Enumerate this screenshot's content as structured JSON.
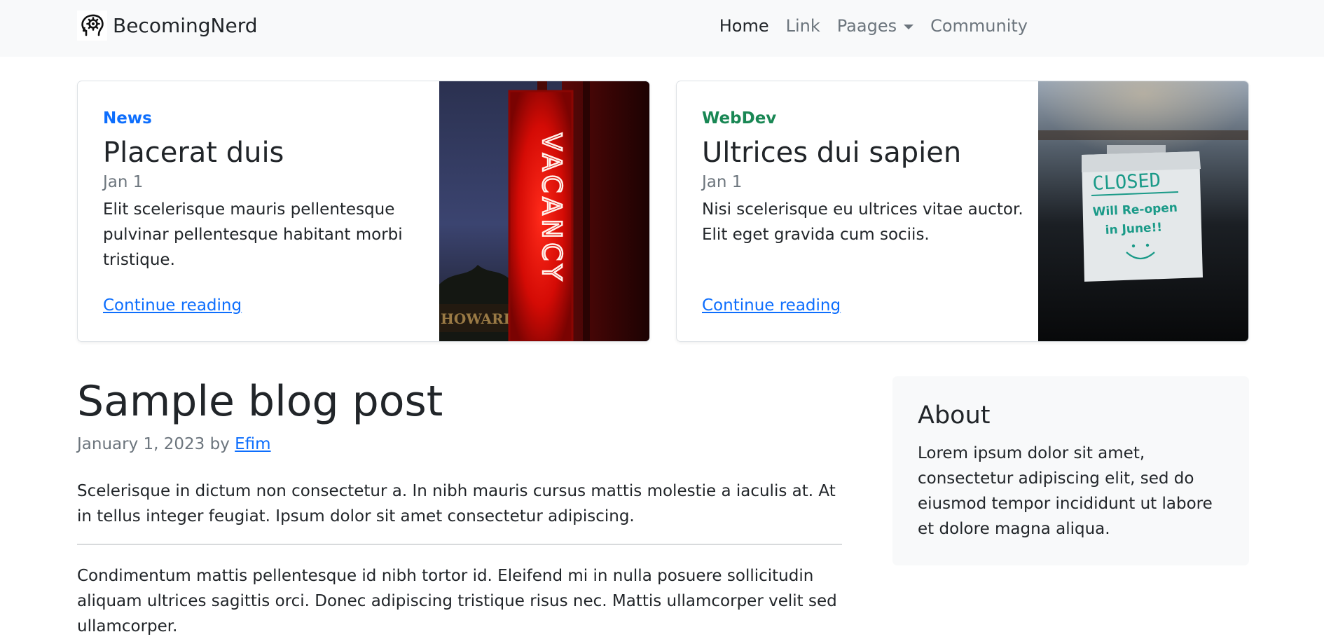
{
  "brand": {
    "name": "BecomingNerd",
    "logo_icon": "brain-gear-icon"
  },
  "nav": {
    "items": [
      {
        "label": "Home",
        "active": true
      },
      {
        "label": "Link",
        "active": false
      },
      {
        "label": "Paages",
        "active": false,
        "dropdown": true
      },
      {
        "label": "Community",
        "active": false
      }
    ]
  },
  "featured": [
    {
      "category": "News",
      "category_color": "#0d6efd",
      "title": "Placerat duis",
      "date": "Jan 1",
      "excerpt": "Elit scelerisque mauris pellentesque pulvinar pellentesque habitant morbi tristique.",
      "link": "Continue reading",
      "image": "neon-vacancy-sign-photo",
      "image_sign_text": "VACANCY",
      "image_storefront_text": "HOWARDS"
    },
    {
      "category": "WebDev",
      "category_color": "#198754",
      "title": "Ultrices dui sapien",
      "date": "Jan 1",
      "excerpt": "Nisi scelerisque eu ultrices vitae auctor. Elit eget gravida cum sociis.",
      "link": "Continue reading",
      "image": "closed-sign-window-photo",
      "image_note_line1": "CLOSED",
      "image_note_line2": "Will Re-open",
      "image_note_line3": "in June!!"
    }
  ],
  "post": {
    "title": "Sample blog post",
    "meta_prefix": "January 1, 2023 by ",
    "author": "Efim",
    "paragraph1": "Scelerisque in dictum non consectetur a. In nibh mauris cursus mattis molestie a iaculis at. At in tellus integer feugiat. Ipsum dolor sit amet consectetur adipiscing.",
    "paragraph2": "Condimentum mattis pellentesque id nibh tortor id. Eleifend mi in nulla posuere sollicitudin aliquam ultrices sagittis orci. Donec adipiscing tristique risus nec. Mattis ullamcorper velit sed ullamcorper."
  },
  "about": {
    "title": "About",
    "text": "Lorem ipsum dolor sit amet, consectetur adipiscing elit, sed do eiusmod tempor incididunt ut labore et dolore magna aliqua."
  }
}
